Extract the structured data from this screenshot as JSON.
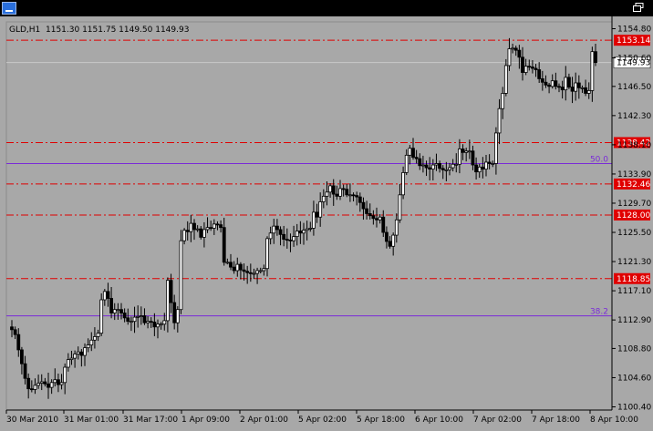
{
  "header": {
    "symbol_label": "GLD,H1",
    "ohlc_label": "1151.30 1151.75 1149.50 1149.93"
  },
  "colors": {
    "background": "#a8a8a8",
    "candle": "#000000",
    "level_line": "#e00000",
    "fib_line": "#7a2bd8",
    "fib_text": "#7a2bd8",
    "current_price_line": "#c8c8c8",
    "label_bg_red": "#e00000",
    "label_bg_white": "#ffffff"
  },
  "chart_data": {
    "type": "candlestick",
    "ylim": [
      1100.4,
      1155.0
    ],
    "price_axis_ticks": [
      "1154.80",
      "1150.60",
      "1146.50",
      "1142.30",
      "1138.10",
      "1133.90",
      "1129.70",
      "1125.50",
      "1121.30",
      "1117.10",
      "1112.90",
      "1108.80",
      "1104.60",
      "1100.40"
    ],
    "time_axis_ticks": [
      "30 Mar 2010",
      "31 Mar 01:00",
      "31 Mar 17:00",
      "1 Apr 09:00",
      "2 Apr 01:00",
      "5 Apr 02:00",
      "5 Apr 18:00",
      "6 Apr 10:00",
      "7 Apr 02:00",
      "7 Apr 18:00",
      "8 Apr 10:00"
    ],
    "horizontal_levels": [
      {
        "price": 1153.14,
        "label": "1153.14"
      },
      {
        "price": 1138.42,
        "label": "1138.42"
      },
      {
        "price": 1132.46,
        "label": "1132.46"
      },
      {
        "price": 1128.0,
        "label": "1128.00"
      },
      {
        "price": 1118.85,
        "label": "1118.85"
      }
    ],
    "fib_levels": [
      {
        "price": 1135.4,
        "label": "50.0"
      },
      {
        "price": 1113.5,
        "label": "38.2"
      }
    ],
    "current_price": {
      "price": 1149.93,
      "label": "1149.93"
    },
    "close_series": [
      1111.5,
      1110.8,
      1108.6,
      1106.6,
      1104.5,
      1103.0,
      1102.9,
      1103.5,
      1103.8,
      1104.0,
      1103.7,
      1103.2,
      1103.9,
      1104.3,
      1103.6,
      1103.9,
      1106.1,
      1107.2,
      1107.4,
      1108.0,
      1108.3,
      1107.8,
      1108.9,
      1109.3,
      1110.0,
      1110.5,
      1111.0,
      1115.8,
      1117.0,
      1116.0,
      1113.9,
      1114.4,
      1114.4,
      1113.9,
      1113.2,
      1112.7,
      1112.7,
      1113.3,
      1113.4,
      1113.5,
      1112.5,
      1112.7,
      1112.6,
      1111.9,
      1112.3,
      1112.3,
      1112.8,
      1118.6,
      1115.4,
      1112.5,
      1114.4,
      1124.3,
      1125.8,
      1125.6,
      1126.8,
      1125.9,
      1126.0,
      1124.8,
      1125.9,
      1126.2,
      1126.1,
      1126.7,
      1126.6,
      1126.2,
      1121.2,
      1121.2,
      1120.5,
      1120.0,
      1120.9,
      1120.1,
      1119.9,
      1119.7,
      1119.6,
      1119.6,
      1120.0,
      1120.0,
      1120.3,
      1124.6,
      1125.4,
      1126.4,
      1125.9,
      1125.2,
      1124.5,
      1124.4,
      1124.3,
      1124.9,
      1125.7,
      1125.4,
      1125.8,
      1126.0,
      1126.1,
      1128.4,
      1127.7,
      1129.9,
      1130.7,
      1131.3,
      1132.2,
      1131.0,
      1130.7,
      1131.8,
      1131.7,
      1130.9,
      1130.9,
      1130.8,
      1130.6,
      1129.8,
      1128.9,
      1128.2,
      1127.9,
      1127.5,
      1127.3,
      1127.7,
      1125.5,
      1124.2,
      1123.5,
      1125.1,
      1127.3,
      1130.9,
      1134.1,
      1136.6,
      1137.6,
      1136.3,
      1136.1,
      1135.1,
      1135.2,
      1134.8,
      1134.6,
      1135.2,
      1135.4,
      1134.7,
      1134.5,
      1134.5,
      1134.8,
      1135.3,
      1135.3,
      1137.5,
      1137.0,
      1137.2,
      1137.2,
      1135.2,
      1134.2,
      1134.9,
      1134.6,
      1135.6,
      1135.4,
      1135.4,
      1139.8,
      1143.3,
      1145.5,
      1149.5,
      1151.9,
      1152.0,
      1151.7,
      1150.7,
      1148.5,
      1149.4,
      1149.3,
      1149.1,
      1148.9,
      1147.6,
      1147.1,
      1146.7,
      1146.5,
      1147.3,
      1146.5,
      1146.4,
      1146.0,
      1147.8,
      1146.4,
      1145.8,
      1147.0,
      1146.3,
      1146.3,
      1145.5,
      1145.9,
      1151.5,
      1149.93
    ]
  }
}
